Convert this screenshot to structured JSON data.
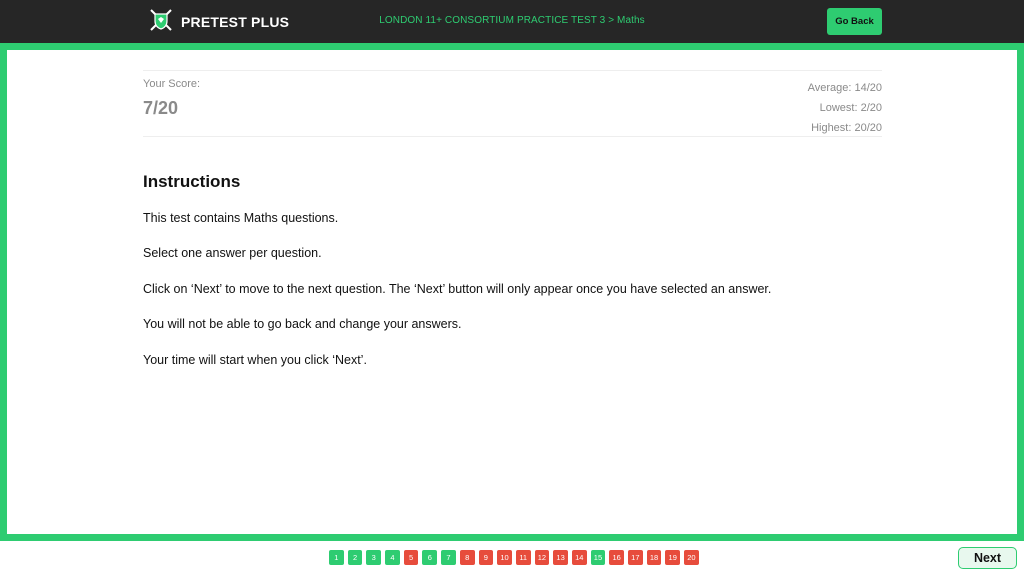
{
  "header": {
    "logo_text": "PRETEST PLUS",
    "breadcrumb": "LONDON 11+ CONSORTIUM PRACTICE TEST 3 > Maths",
    "go_back_label": "Go Back",
    "logo_icon": "shield-swords-icon"
  },
  "score": {
    "label": "Your Score:",
    "value": "7/20",
    "average": "Average: 14/20",
    "lowest": "Lowest: 2/20",
    "highest": "Highest: 20/20"
  },
  "instructions": {
    "title": "Instructions",
    "lines": [
      "This test contains Maths questions.",
      "Select one answer per question.",
      "Click on ‘Next’ to move to the next question. The ‘Next’ button will only appear once you have selected an answer.",
      "You will not be able to go back and change your answers.",
      "Your time will start when you click ‘Next’."
    ]
  },
  "question_nav": [
    {
      "label": "1",
      "status": "correct"
    },
    {
      "label": "2",
      "status": "correct"
    },
    {
      "label": "3",
      "status": "correct"
    },
    {
      "label": "4",
      "status": "correct"
    },
    {
      "label": "5",
      "status": "wrong"
    },
    {
      "label": "6",
      "status": "correct"
    },
    {
      "label": "7",
      "status": "correct"
    },
    {
      "label": "8",
      "status": "wrong"
    },
    {
      "label": "9",
      "status": "wrong"
    },
    {
      "label": "10",
      "status": "wrong"
    },
    {
      "label": "11",
      "status": "wrong"
    },
    {
      "label": "12",
      "status": "wrong"
    },
    {
      "label": "13",
      "status": "wrong"
    },
    {
      "label": "14",
      "status": "wrong"
    },
    {
      "label": "15",
      "status": "correct"
    },
    {
      "label": "16",
      "status": "wrong"
    },
    {
      "label": "17",
      "status": "wrong"
    },
    {
      "label": "18",
      "status": "wrong"
    },
    {
      "label": "19",
      "status": "wrong"
    },
    {
      "label": "20",
      "status": "wrong"
    }
  ],
  "footer": {
    "next_label": "Next"
  },
  "colors": {
    "accent": "#2ecc71",
    "wrong": "#e74c3c",
    "header_bg": "#262626"
  }
}
